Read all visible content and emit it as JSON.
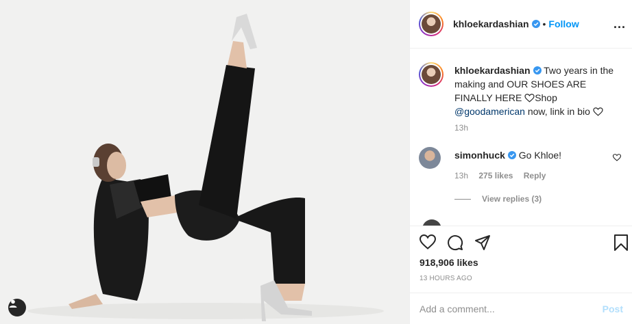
{
  "header": {
    "username": "khloekardashian",
    "separator": "•",
    "follow_label": "Follow",
    "more_label": "..."
  },
  "caption": {
    "username": "khloekardashian",
    "text_part1": "Two years in the making and OUR SHOES ARE FINALLY HERE ",
    "text_part2": "Shop ",
    "mention": "@goodamerican",
    "text_part3": " now, link in bio ",
    "time": "13h"
  },
  "comments": [
    {
      "username": "simonhuck",
      "text": "Go Khloe!",
      "time": "13h",
      "likes": "275 likes",
      "reply_label": "Reply",
      "view_replies": "View replies (3)"
    }
  ],
  "actions": {
    "likes": "918,906 likes",
    "timestamp": "13 HOURS AGO"
  },
  "add_comment": {
    "placeholder": "Add a comment...",
    "post_label": "Post"
  },
  "colors": {
    "accent": "#0095f6",
    "verified": "#3897f0",
    "post_disabled": "#b2dffc"
  },
  "icons": [
    "heart-icon",
    "comment-icon",
    "share-icon",
    "bookmark-icon",
    "verified-icon",
    "more-icon",
    "user-tag-icon"
  ]
}
